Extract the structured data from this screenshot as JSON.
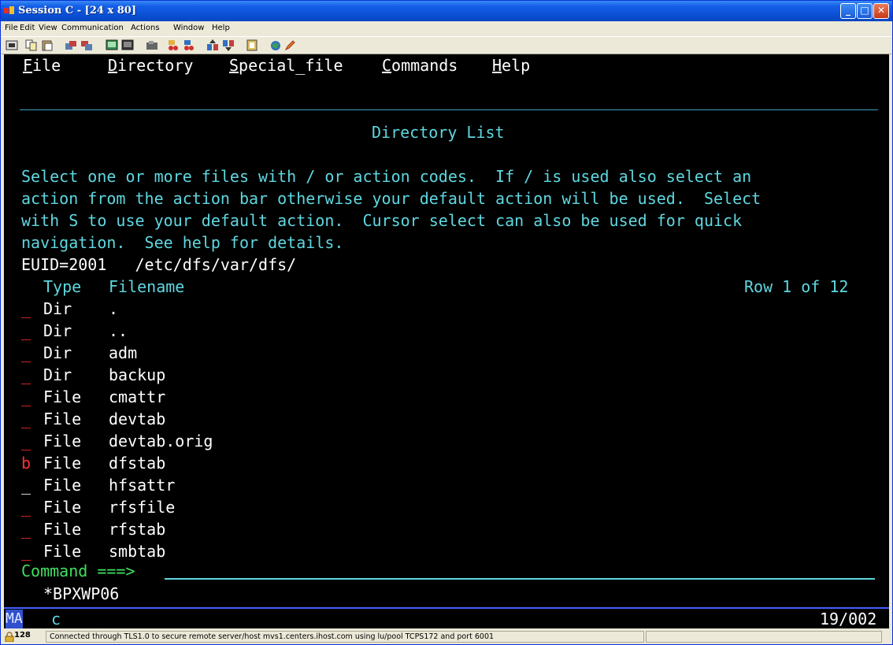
{
  "window": {
    "title": "Session C - [24 x 80]"
  },
  "menu": [
    "File",
    "Edit",
    "View",
    "Communication",
    "Actions",
    "Window",
    "Help"
  ],
  "action_bar": [
    "File",
    "Directory",
    "Special_file",
    "Commands",
    "Help"
  ],
  "panel_title": "Directory List",
  "instructions": [
    "Select one or more files with / or action codes.  If / is used also select an",
    "action from the action bar otherwise your default action will be used.  Select",
    "with S to use your default action.  Cursor select can also be used for quick",
    "navigation.  See help for details."
  ],
  "euid_line": "EUID=2001   /etc/dfs/var/dfs/",
  "headers": {
    "type": "Type",
    "filename": "Filename",
    "row": "Row 1 of 12"
  },
  "rows": [
    {
      "sel": "_",
      "type": "Dir",
      "name": "."
    },
    {
      "sel": "_",
      "type": "Dir",
      "name": ".."
    },
    {
      "sel": "_",
      "type": "Dir",
      "name": "adm"
    },
    {
      "sel": "_",
      "type": "Dir",
      "name": "backup"
    },
    {
      "sel": "_",
      "type": "File",
      "name": "cmattr"
    },
    {
      "sel": "_",
      "type": "File",
      "name": "devtab"
    },
    {
      "sel": "_",
      "type": "File",
      "name": "devtab.orig"
    },
    {
      "sel": "b",
      "type": "File",
      "name": "dfstab"
    },
    {
      "sel": "_",
      "type": "File",
      "name": "hfsattr"
    },
    {
      "sel": "_",
      "type": "File",
      "name": "rfsfile"
    },
    {
      "sel": "_",
      "type": "File",
      "name": "rfstab"
    },
    {
      "sel": "_",
      "type": "File",
      "name": "smbtab"
    }
  ],
  "command_label": "Command ===>",
  "command_value": "",
  "message": "*BPXWP06",
  "oia": {
    "left": "MA",
    "session": "c",
    "position": "19/002"
  },
  "status": {
    "code": "128",
    "text": "Connected through TLS1.0 to secure remote server/host mvs1.centers.ihost.com using lu/pool TCPS172 and port 6001"
  },
  "colors": {
    "terminal_bg": "#000000",
    "cyan": "#5fd7e0",
    "green": "#40e060",
    "red": "#ff3030",
    "titlebar": "#0a4fd4"
  },
  "icons": [
    "app-icon",
    "minimize-icon",
    "maximize-icon",
    "close-icon",
    "lock-icon"
  ]
}
